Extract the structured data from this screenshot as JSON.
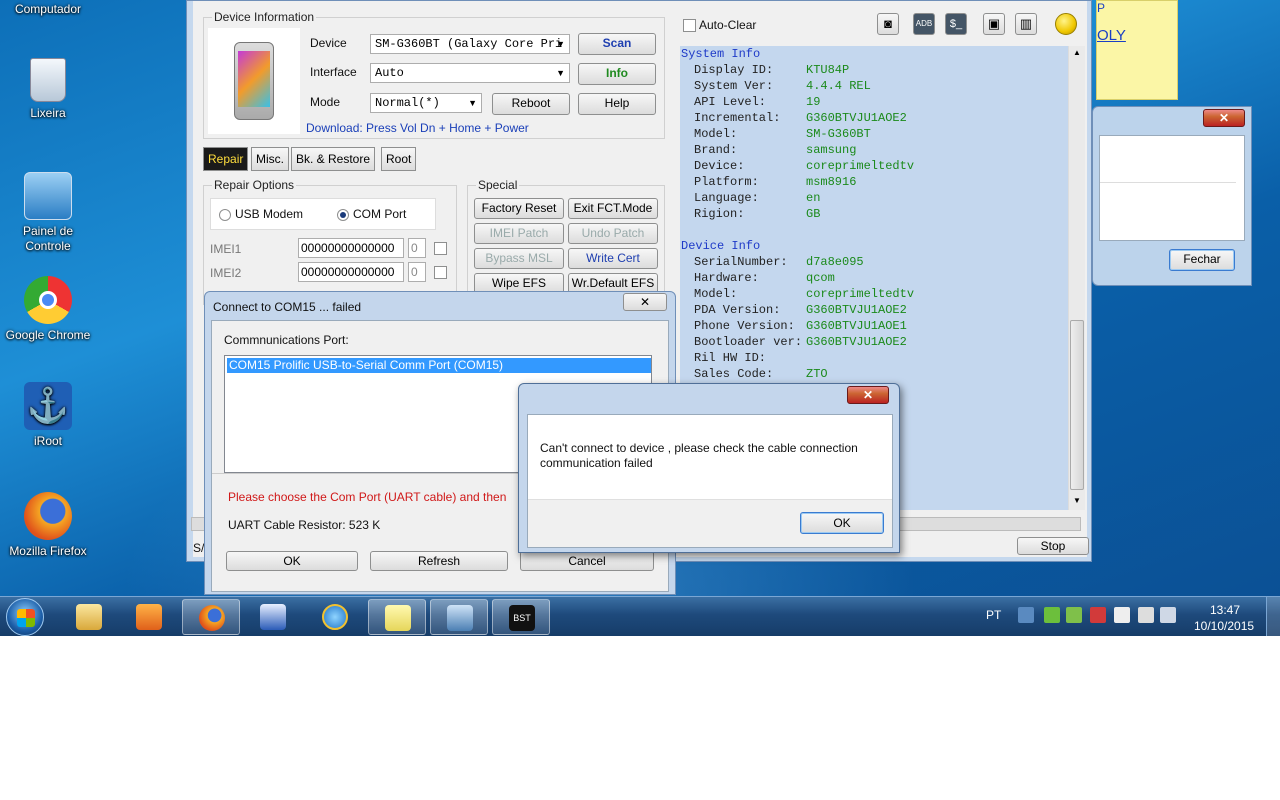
{
  "desktop": {
    "icons": [
      {
        "label": "Computador"
      },
      {
        "label": "Lixeira"
      },
      {
        "label": "Painel de Controle"
      },
      {
        "label": "Google Chrome"
      },
      {
        "label": "iRoot"
      },
      {
        "label": "Mozilla Firefox"
      }
    ],
    "sticky_text": "OLY",
    "sticky_text2": "P"
  },
  "fechar_dialog": {
    "close": "✕",
    "button": "Fechar"
  },
  "main": {
    "device_info_title": "Device Information",
    "device_label": "Device",
    "device_value": "SM-G360BT (Galaxy Core Pri",
    "interface_label": "Interface",
    "interface_value": "Auto",
    "mode_label": "Mode",
    "mode_value": "Normal(*)",
    "scan": "Scan",
    "info": "Info",
    "reboot": "Reboot",
    "help": "Help",
    "download_hint": "Download: Press Vol Dn + Home + Power",
    "tabs": [
      "Repair",
      "Misc.",
      "Bk. & Restore",
      "Root"
    ],
    "repair_options_title": "Repair Options",
    "usb_modem": "USB Modem",
    "com_port": "COM Port",
    "imei1_label": "IMEI1",
    "imei1_value": "00000000000000",
    "imei1_small": "0",
    "imei2_label": "IMEI2",
    "imei2_value": "00000000000000",
    "imei2_small": "0",
    "special_title": "Special",
    "special_buttons": [
      "Factory Reset",
      "Exit FCT.Mode",
      "IMEI Patch",
      "Undo Patch",
      "Bypass MSL",
      "Write Cert",
      "Wipe EFS",
      "Wr.Default EFS"
    ],
    "auto_clear": "Auto-Clear",
    "toolbar_adb": "ADB",
    "toolbar_dollar": "$_",
    "stop": "Stop",
    "status_prefix": "S/"
  },
  "info_panel": {
    "system_title": "System Info",
    "system": [
      {
        "k": "Display ID:",
        "v": "KTU84P"
      },
      {
        "k": "System Ver:",
        "v": "4.4.4 REL"
      },
      {
        "k": "API Level:",
        "v": "19"
      },
      {
        "k": "Incremental:",
        "v": "G360BTVJU1AOE2"
      },
      {
        "k": "Model:",
        "v": "SM-G360BT"
      },
      {
        "k": "Brand:",
        "v": "samsung"
      },
      {
        "k": "Device:",
        "v": "coreprimeltedtv"
      },
      {
        "k": "Platform:",
        "v": "msm8916"
      },
      {
        "k": "Language:",
        "v": "en"
      },
      {
        "k": "Rigion:",
        "v": "GB"
      }
    ],
    "device_title": "Device Info",
    "device": [
      {
        "k": "SerialNumber:",
        "v": "d7a8e095"
      },
      {
        "k": "Hardware:",
        "v": "qcom"
      },
      {
        "k": "Model:",
        "v": "coreprimeltedtv"
      },
      {
        "k": "PDA Version:",
        "v": "G360BTVJU1AOE2"
      },
      {
        "k": "Phone Version:",
        "v": "G360BTVJU1AOE1"
      },
      {
        "k": "Bootloader ver:",
        "v": "G360BTVJU1AOE2"
      },
      {
        "k": "Ril HW ID:",
        "v": ""
      },
      {
        "k": "Sales Code:",
        "v": "ZTO"
      }
    ]
  },
  "com_dialog": {
    "title": "Connect to COM15 ... failed",
    "port_label": "Commnunications Port:",
    "selected_port": "COM15 Prolific USB-to-Serial Comm Port (COM15)",
    "warning": "Please choose the Com Port (UART cable) and then",
    "resistor": "UART Cable Resistor: 523 K",
    "ok": "OK",
    "refresh": "Refresh",
    "cancel": "Cancel",
    "close": "✕"
  },
  "error_dialog": {
    "line1": "Can't connect to device , please check the cable connection",
    "line2": "communication failed",
    "ok": "OK",
    "close": "✕"
  },
  "taskbar": {
    "language": "PT",
    "time": "13:47",
    "date": "10/10/2015",
    "bst_label": "BST"
  },
  "colors": {
    "desktop": "#1e8fd6",
    "info_bg": "#c4d7ee",
    "info_key_section": "#1e3ac8",
    "info_value": "#1b8a1b",
    "warning_red": "#d01818"
  }
}
